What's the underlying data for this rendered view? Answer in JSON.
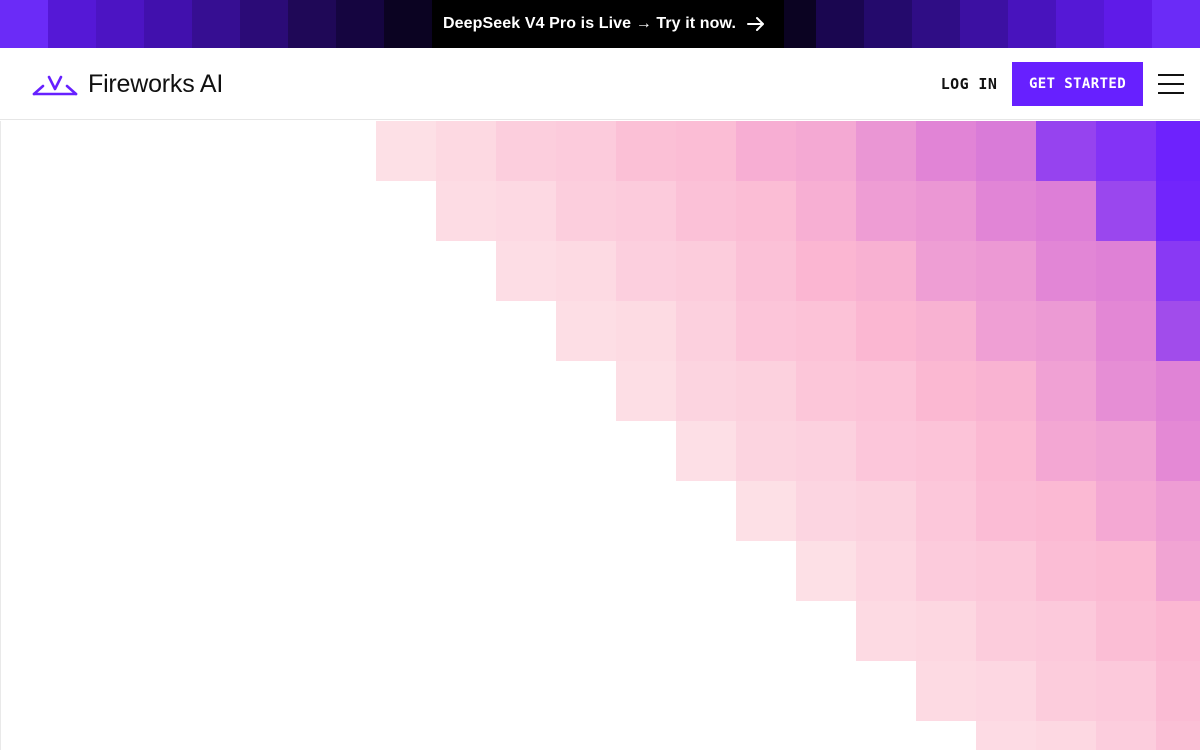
{
  "banner": {
    "text": "DeepSeek V4 Pro is Live → Try it now.",
    "arrow_icon": "arrow-right-icon",
    "tile_colors": [
      "#6b2bf7",
      "#5518d6",
      "#4c14c3",
      "#4110ad",
      "#360e92",
      "#2b0b77",
      "#1f0857",
      "#150540",
      "#0b0322",
      "#05010f",
      "#000000",
      "#000000",
      "#000000",
      "#000000",
      "#000000",
      "#000000",
      "#0b0322",
      "#1a0650",
      "#240a6c",
      "#2f0d85",
      "#3c10a2",
      "#4813bd",
      "#5518d6",
      "#5f1be8",
      "#6b2bf7"
    ]
  },
  "header": {
    "logo_icon": "fireworks-logo-icon",
    "logo_text": "Fireworks AI",
    "login_label": "LOG IN",
    "cta_label": "GET STARTED",
    "menu_icon": "hamburger-menu-icon",
    "accent_color": "#6720ff"
  },
  "hero": {
    "pattern_colors": {
      "light": "#fde0e6",
      "pink": "#fbb7d2",
      "magenta": "#df80d6",
      "violet": "#6e22fd"
    }
  }
}
